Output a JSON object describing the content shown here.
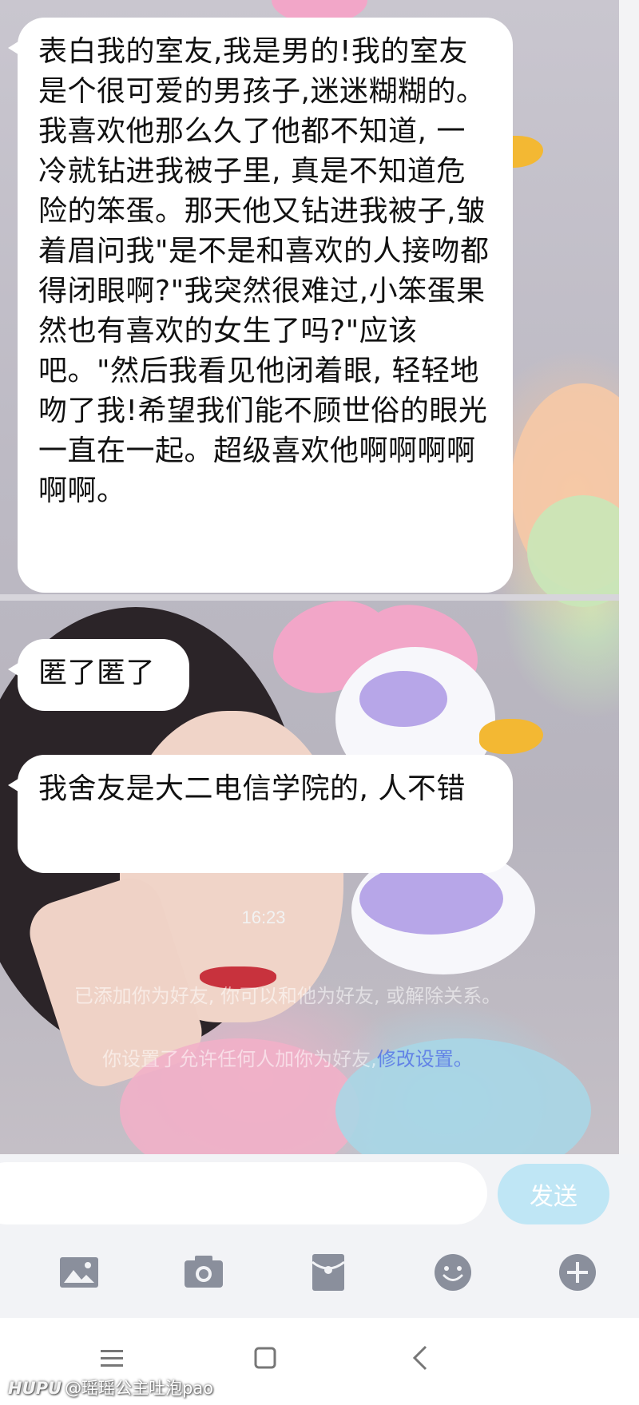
{
  "messages": [
    {
      "text": "表白我的室友,我是男的!我的室友是个很可爱的男孩子,迷迷糊糊的。我喜欢他那么久了他都不知道, 一冷就钻进我被子里, 真是不知道危险的笨蛋。那天他又钻进我被子,皱着眉问我\"是不是和喜欢的人接吻都得闭眼啊?\"我突然很难过,小笨蛋果然也有喜欢的女生了吗?\"应该吧。\"然后我看见他闭着眼, 轻轻地吻了我!希望我们能不顾世俗的眼光一直在一起。超级喜欢他啊啊啊啊啊啊。"
    },
    {
      "text": "匿了匿了"
    },
    {
      "text": "我舍友是大二电信学院的, 人不错"
    }
  ],
  "system": {
    "time": "16:23",
    "notice_1": "已添加你为好友, 你可以和他为好友, 或解除关系。",
    "notice_2_prefix": "你设置了允许任何人加你为好友,",
    "notice_2_link": "修改设置。"
  },
  "composer": {
    "input_value": "",
    "input_placeholder": "",
    "send_label": "发送"
  },
  "toolbar": {
    "icons": [
      "image-icon",
      "camera-icon",
      "red-packet-icon",
      "emoji-icon",
      "plus-icon"
    ]
  },
  "navbar": {
    "icons": [
      "menu-icon",
      "home-square-icon",
      "back-chevron-icon"
    ]
  },
  "watermark": {
    "brand": "HUPU",
    "handle": "@瑶瑶公主吐泡pao"
  },
  "colors": {
    "send_button": "#bfe6f5",
    "toolbar_icon": "#8a8f9c",
    "link": "#506ee6"
  }
}
